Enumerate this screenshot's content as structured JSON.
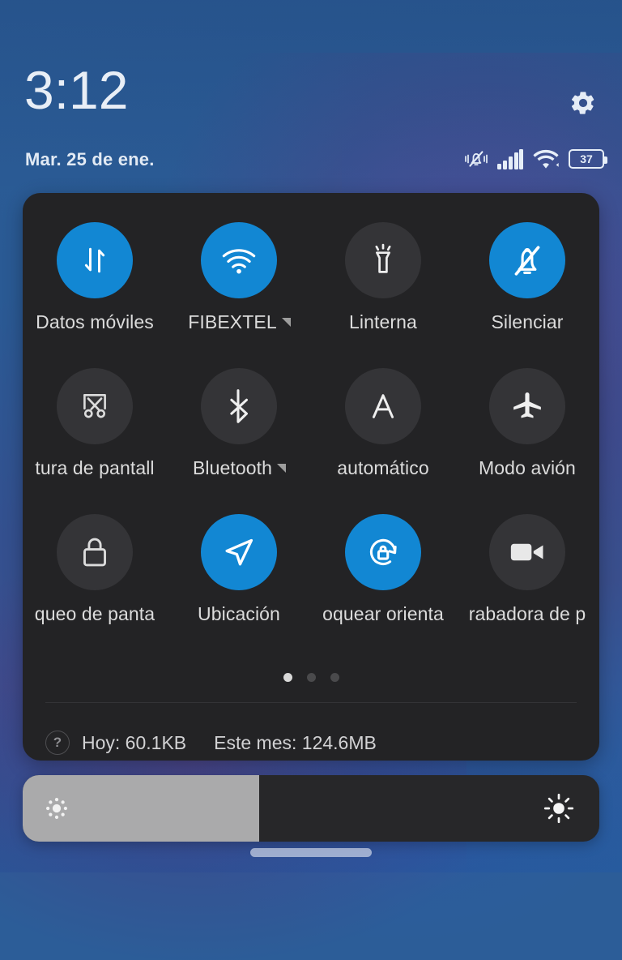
{
  "statusbar": {
    "clock": "3:12",
    "date": "Mar. 25 de ene.",
    "battery_percent": "37",
    "icons": [
      "vibrate-off-icon",
      "signal-bars-icon",
      "wifi-icon",
      "battery-icon"
    ],
    "settings_icon": "gear-icon"
  },
  "colors": {
    "accent_active": "#1287d3",
    "tile_inactive": "#343437",
    "panel_bg": "#232325",
    "slider_fill": "#aaaaab",
    "slider_track": "#272729",
    "text_primary": "#dcdcdc"
  },
  "quick_settings": {
    "tiles": [
      {
        "label": "Datos móviles",
        "icon": "mobile-data-icon",
        "active": true,
        "has_expand": false,
        "clipped": false,
        "name": "tile-mobile-data"
      },
      {
        "label": "FIBEXTEL",
        "icon": "wifi-icon",
        "active": true,
        "has_expand": true,
        "clipped": false,
        "name": "tile-wifi"
      },
      {
        "label": "Linterna",
        "icon": "flashlight-icon",
        "active": false,
        "has_expand": false,
        "clipped": false,
        "name": "tile-flashlight"
      },
      {
        "label": "Silenciar",
        "icon": "bell-off-icon",
        "active": true,
        "has_expand": false,
        "clipped": false,
        "name": "tile-silent"
      },
      {
        "label": "tura de pantall",
        "icon": "screenshot-scissors-icon",
        "active": false,
        "has_expand": false,
        "clipped": true,
        "name": "tile-screenshot"
      },
      {
        "label": "Bluetooth",
        "icon": "bluetooth-icon",
        "active": false,
        "has_expand": true,
        "clipped": false,
        "name": "tile-bluetooth"
      },
      {
        "label": "automático",
        "icon": "auto-brightness-a-icon",
        "active": false,
        "has_expand": false,
        "clipped": true,
        "name": "tile-auto-brightness"
      },
      {
        "label": "Modo avión",
        "icon": "airplane-icon",
        "active": false,
        "has_expand": false,
        "clipped": false,
        "name": "tile-airplane-mode"
      },
      {
        "label": "queo de panta",
        "icon": "lock-icon",
        "active": false,
        "has_expand": false,
        "clipped": true,
        "name": "tile-screen-lock"
      },
      {
        "label": "Ubicación",
        "icon": "location-arrow-icon",
        "active": true,
        "has_expand": false,
        "clipped": false,
        "name": "tile-location"
      },
      {
        "label": "oquear orienta",
        "icon": "rotation-lock-icon",
        "active": true,
        "has_expand": false,
        "clipped": true,
        "name": "tile-rotation-lock"
      },
      {
        "label": "rabadora de p",
        "icon": "video-camera-icon",
        "active": false,
        "has_expand": false,
        "clipped": true,
        "name": "tile-screen-recorder"
      }
    ],
    "pages": {
      "count": 3,
      "active_index": 0
    },
    "data_usage": {
      "help_icon": "question-mark-icon",
      "today": "Hoy: 60.1KB",
      "this_month": "Este mes: 124.6MB"
    }
  },
  "brightness": {
    "value_percent": 41,
    "low_icon": "brightness-low-icon",
    "high_icon": "brightness-high-icon"
  },
  "navigation": {
    "pill": "home-gesture-pill"
  }
}
